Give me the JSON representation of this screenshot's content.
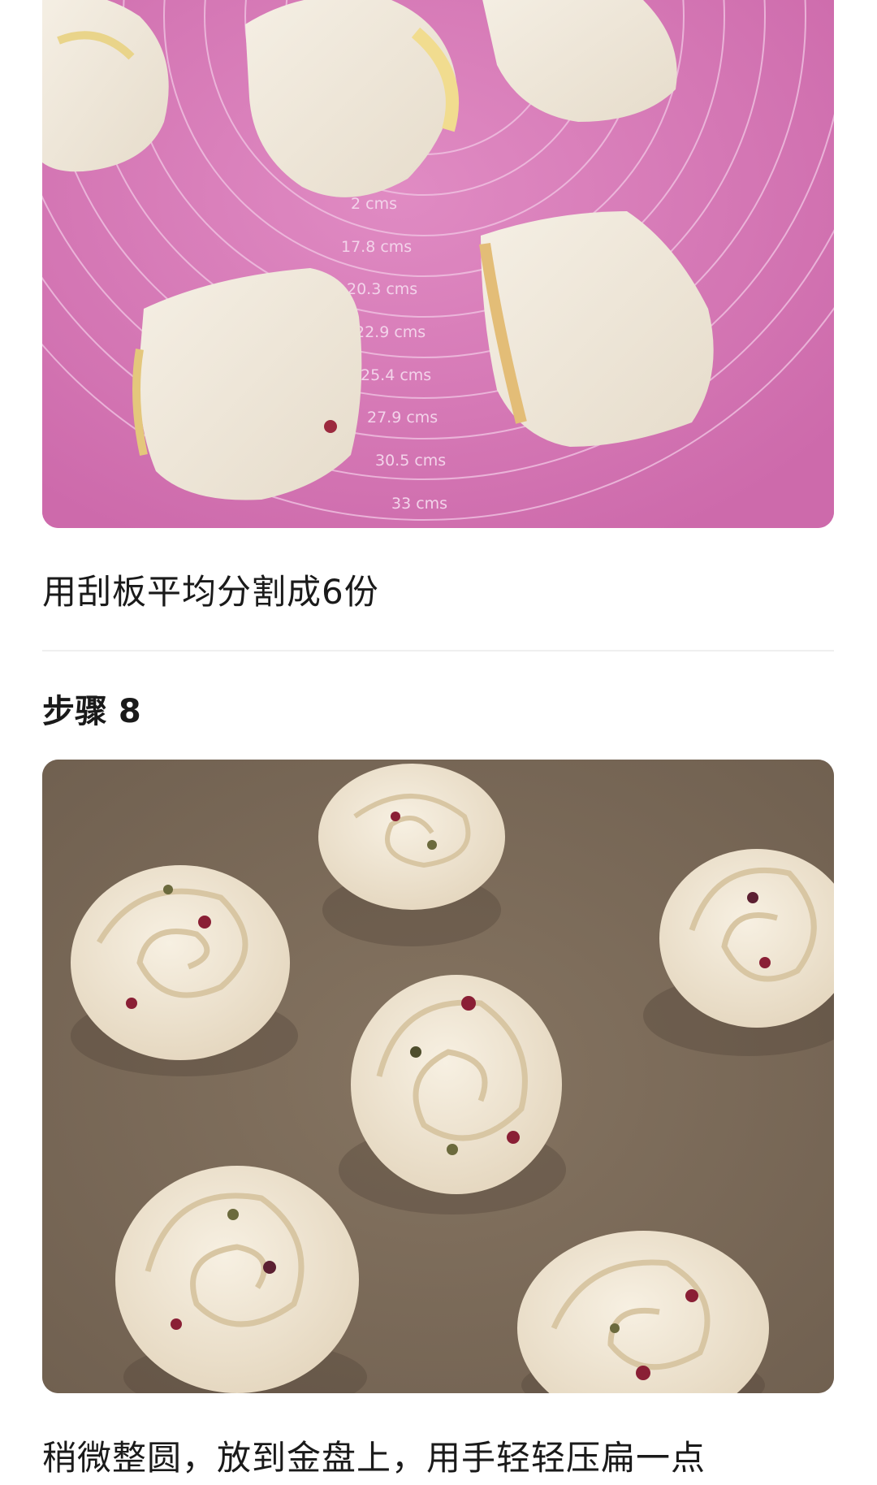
{
  "steps": [
    {
      "description": "用刮板平均分割成6份",
      "photo": {
        "subject": "six cut dough rolls on a pink silicone mat",
        "mat_color": "#d778b8",
        "ruler_labels": [
          "2 cms",
          "17.8 cms",
          "20.3 cms",
          "22.9 cms",
          "25.4 cms",
          "27.9 cms",
          "30.5 cms",
          "33 cms"
        ]
      }
    },
    {
      "title": "步骤 8",
      "description": "稍微整圆，放到金盘上，用手轻轻压扁一点",
      "photo": {
        "subject": "rounded spiral dough rolls on a brown baking tray",
        "tray_color": "#7a6a59"
      }
    }
  ]
}
